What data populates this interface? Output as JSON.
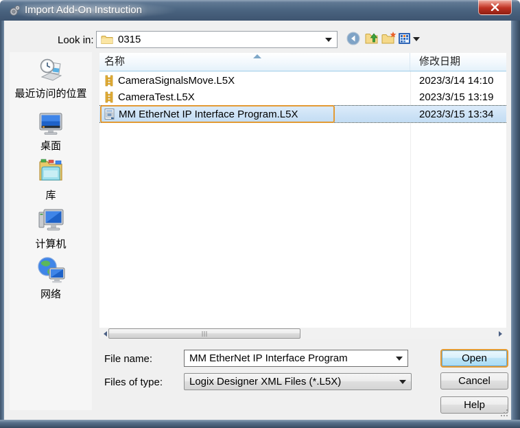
{
  "window": {
    "title": "Import Add-On Instruction"
  },
  "toolbar": {
    "look_in_label": "Look in:",
    "look_in_value": "0315"
  },
  "sidebar": {
    "items": [
      {
        "label": "最近访问的位置"
      },
      {
        "label": "桌面"
      },
      {
        "label": "库"
      },
      {
        "label": "计算机"
      },
      {
        "label": "网络"
      }
    ]
  },
  "filelist": {
    "columns": {
      "name": "名称",
      "date": "修改日期"
    },
    "rows": [
      {
        "name": "CameraSignalsMove.L5X",
        "date": "2023/3/14 14:10"
      },
      {
        "name": "CameraTest.L5X",
        "date": "2023/3/15 13:19"
      },
      {
        "name": "MM EtherNet IP Interface Program.L5X",
        "date": "2023/3/15 13:34"
      }
    ]
  },
  "fields": {
    "file_name_label": "File name:",
    "file_name_value": "MM EtherNet IP Interface Program",
    "file_type_label": "Files of type:",
    "file_type_value": "Logix Designer XML Files (*.L5X)"
  },
  "buttons": {
    "open": "Open",
    "cancel": "Cancel",
    "help": "Help"
  },
  "colors": {
    "titlebar": "#4A6480",
    "selection": "#C2DCF3",
    "annotation_orange": "#E39A33",
    "close_red": "#BE3223"
  }
}
